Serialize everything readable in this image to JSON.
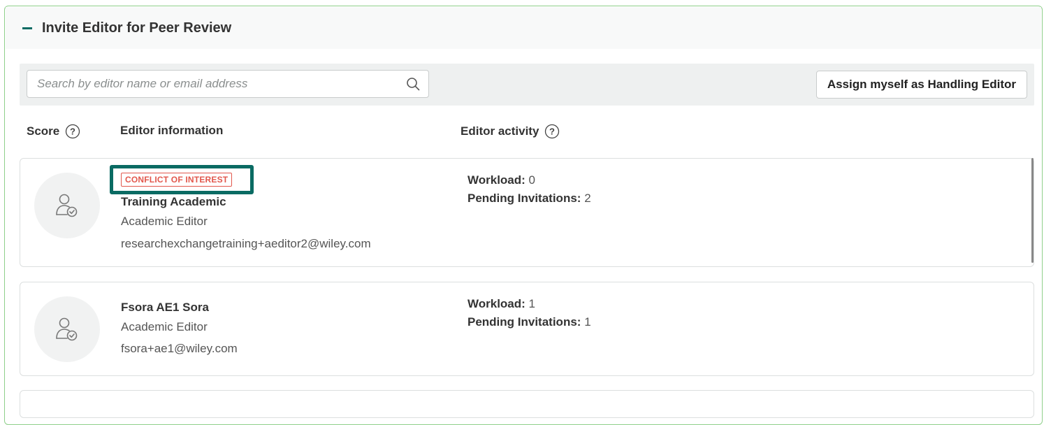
{
  "panel": {
    "title": "Invite Editor for Peer Review"
  },
  "search": {
    "placeholder": "Search by editor name or email address"
  },
  "assign_button": "Assign myself as Handling Editor",
  "columns": {
    "score": "Score",
    "editor_information": "Editor information",
    "editor_activity": "Editor activity"
  },
  "editors": [
    {
      "badge": "CONFLICT OF INTEREST",
      "name": "Training Academic",
      "role": "Academic Editor",
      "email": "researchexchangetraining+aeditor2@wiley.com",
      "workload_label": "Workload:",
      "workload": "0",
      "pending_label": "Pending Invitations:",
      "pending": "2"
    },
    {
      "name": "Fsora AE1 Sora",
      "role": "Academic Editor",
      "email": "fsora+ae1@wiley.com",
      "workload_label": "Workload:",
      "workload": "1",
      "pending_label": "Pending Invitations:",
      "pending": "1"
    }
  ],
  "colors": {
    "accent": "#0a6b63",
    "conflict": "#e2574c",
    "panel_border": "#8ecf8a"
  }
}
